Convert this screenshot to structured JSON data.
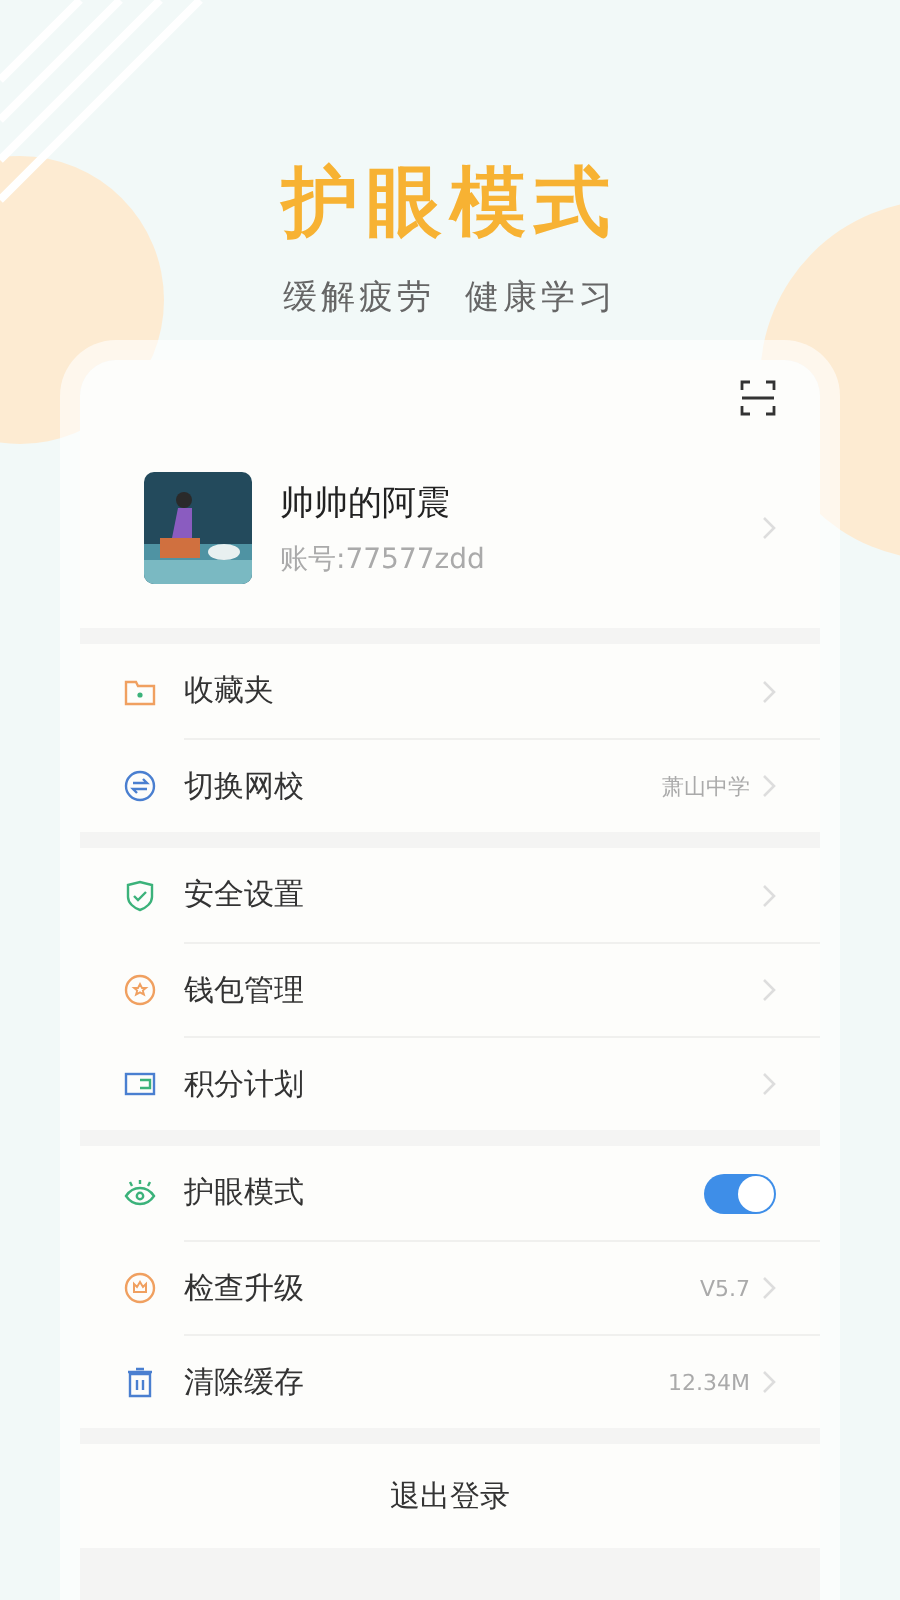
{
  "header": {
    "title": "护眼模式",
    "subtitle": "缓解疲劳  健康学习"
  },
  "profile": {
    "name": "帅帅的阿震",
    "account": "账号:77577zdd"
  },
  "groups": [
    {
      "items": [
        {
          "kind": "link",
          "label": "收藏夹"
        },
        {
          "kind": "link",
          "label": "切换网校",
          "value": "萧山中学"
        }
      ]
    },
    {
      "items": [
        {
          "kind": "link",
          "label": "安全设置"
        },
        {
          "kind": "link",
          "label": "钱包管理"
        },
        {
          "kind": "link",
          "label": "积分计划"
        }
      ]
    },
    {
      "items": [
        {
          "kind": "toggle",
          "label": "护眼模式",
          "on": true
        },
        {
          "kind": "link",
          "label": "检查升级",
          "value": "V5.7"
        },
        {
          "kind": "link",
          "label": "清除缓存",
          "value": "12.34M"
        }
      ]
    }
  ],
  "logout": "退出登录"
}
